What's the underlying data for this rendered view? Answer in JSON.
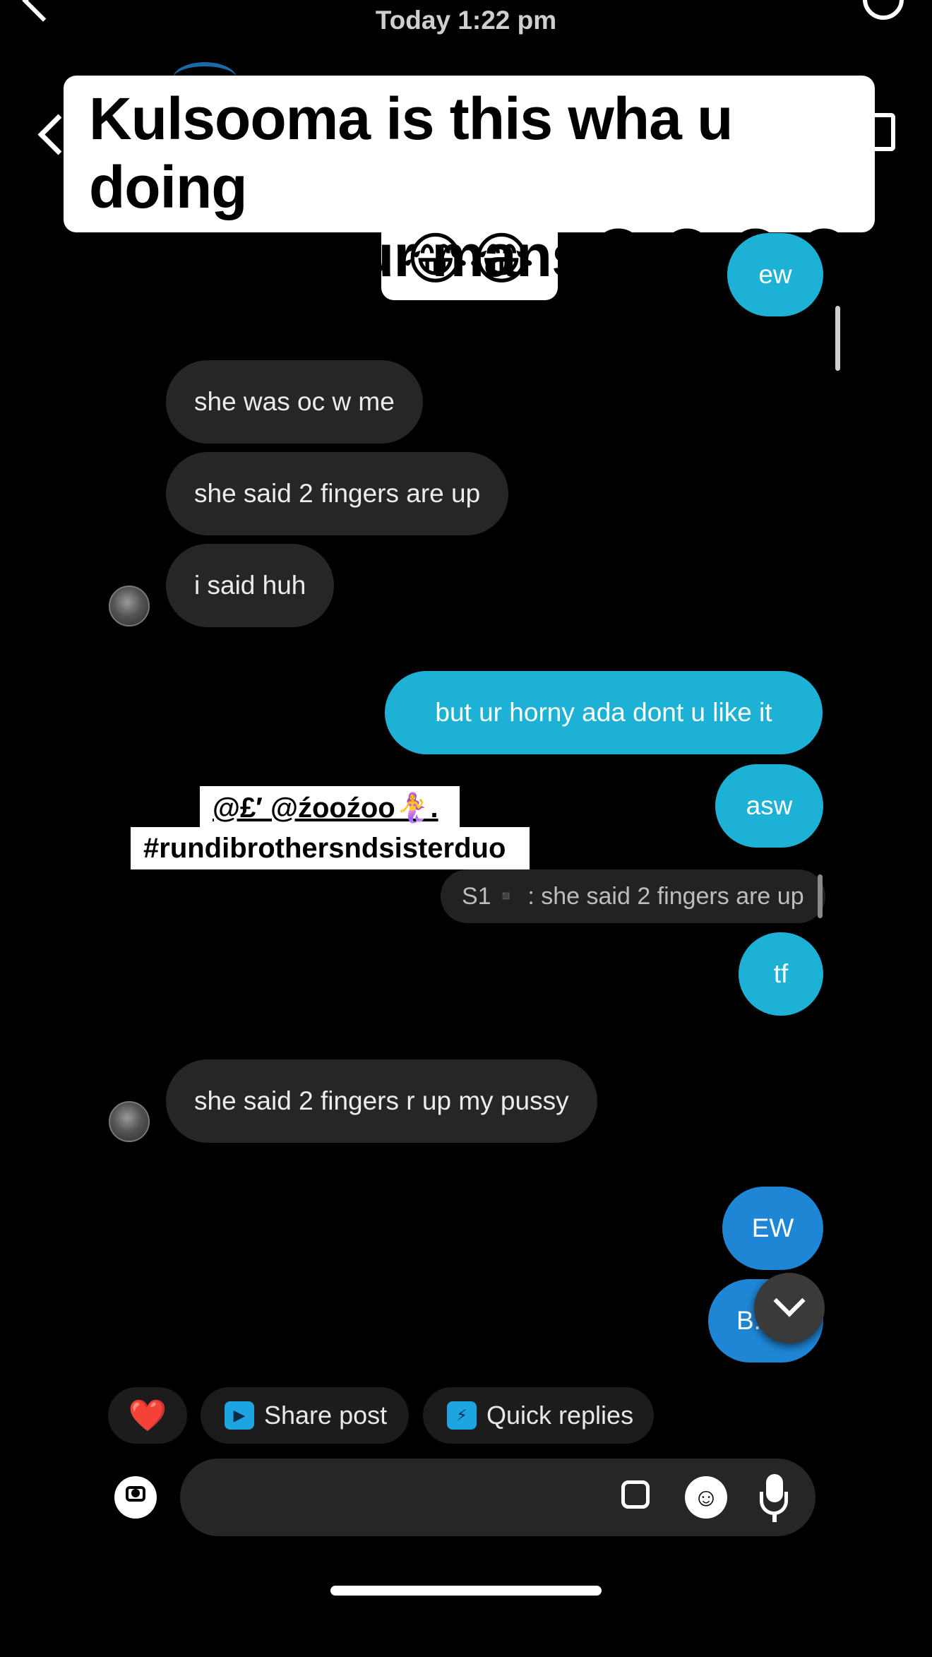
{
  "header": {
    "timestamp": "Today 1:22 pm"
  },
  "caption": {
    "line1": "Kulsooma is this wha u doing",
    "line2": "on call to ur mans😂😂😂😂😂",
    "line3": "😂😂"
  },
  "messages": [
    {
      "from": "me",
      "text": "ew"
    },
    {
      "from": "them",
      "text": "she was oc w me"
    },
    {
      "from": "them",
      "text": "she said 2 fingers are up"
    },
    {
      "from": "them",
      "text": "i said huh"
    },
    {
      "from": "me",
      "text": "but ur horny ada dont u like it"
    },
    {
      "from": "me",
      "text": "asw"
    },
    {
      "from": "me",
      "reply_to": "S1▪️ : she said 2 fingers are up",
      "text": "tf"
    },
    {
      "from": "them",
      "text": "she said 2 fingers r up my pussy"
    },
    {
      "from": "me",
      "text": "EW"
    },
    {
      "from": "me",
      "text": "B."
    }
  ],
  "tags": {
    "mentions": "@£′ @źooźoo🧜‍♀️.",
    "hashtag": "#rundibrothersndsisterduo"
  },
  "quick_actions": {
    "heart": "❤️",
    "share_post": "Share post",
    "quick_replies": "Quick replies"
  },
  "icons": {
    "camera": "camera-icon",
    "gallery": "gallery-icon",
    "sticker": "sticker-icon",
    "mic": "microphone-icon",
    "scroll_down": "chevron-down-icon"
  },
  "colors": {
    "outgoing_bubble": "#1eb1d6",
    "outgoing_bubble_dark": "#1f86d6",
    "incoming_bubble": "#262626",
    "background": "#000000"
  }
}
